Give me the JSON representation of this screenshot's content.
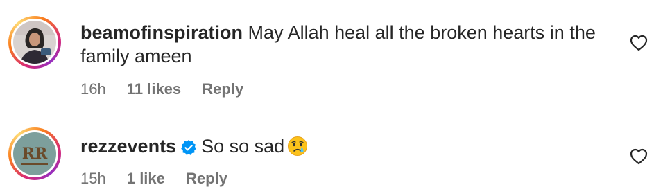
{
  "comments": [
    {
      "username": "beamofinspiration",
      "verified": false,
      "text_line1": "May Allah heal all the broken hearts in the",
      "text_line2": "family ameen",
      "time": "16h",
      "likes": "11 likes",
      "reply": "Reply"
    },
    {
      "username": "rezzevents",
      "verified": true,
      "text_line1": "So so sad",
      "emoji": "crying-face",
      "time": "15h",
      "likes": "1 like",
      "reply": "Reply"
    }
  ],
  "colors": {
    "text": "#262626",
    "meta": "#737373",
    "verified": "#0095f6",
    "ring_start": "#d62976",
    "ring_end": "#feda75"
  },
  "icons": [
    "heart-icon",
    "verified-badge-icon",
    "crying-face-emoji"
  ]
}
